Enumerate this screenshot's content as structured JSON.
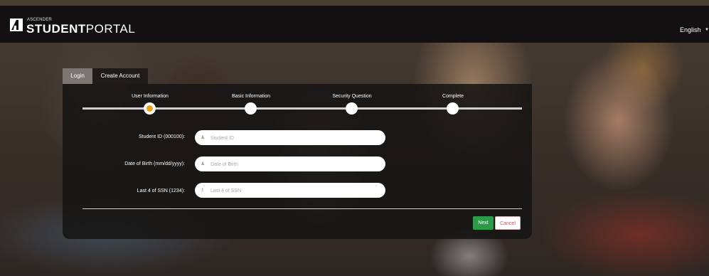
{
  "header": {
    "brand_small": "ASCENDER",
    "brand_bold": "STUDENT",
    "brand_light": "PORTAL",
    "language": "English"
  },
  "tabs": [
    {
      "label": "Login"
    },
    {
      "label": "Create Account"
    }
  ],
  "steps": [
    {
      "label": "User Information",
      "active": true
    },
    {
      "label": "Basic Information",
      "active": false
    },
    {
      "label": "Security Question",
      "active": false
    },
    {
      "label": "Complete",
      "active": false
    }
  ],
  "form": {
    "student_id": {
      "label": "Student ID (000100):",
      "placeholder": "Student ID",
      "value": ""
    },
    "dob": {
      "label": "Date of Birth (mm/dd/yyyy):",
      "placeholder": "Date of Birth",
      "value": ""
    },
    "ssn": {
      "label": "Last 4 of SSN (1234):",
      "placeholder": "Last 4 of SSN",
      "value": ""
    }
  },
  "buttons": {
    "next": "Next",
    "cancel": "Cancel"
  },
  "colors": {
    "accent": "#e7a41a",
    "next": "#2c9b48",
    "cancel_text": "#d0534f"
  },
  "icons": {
    "logo": "ascender-logo-icon",
    "language_caret": "caret-down-icon",
    "user_field": "user-icon",
    "key_field": "key-icon"
  }
}
